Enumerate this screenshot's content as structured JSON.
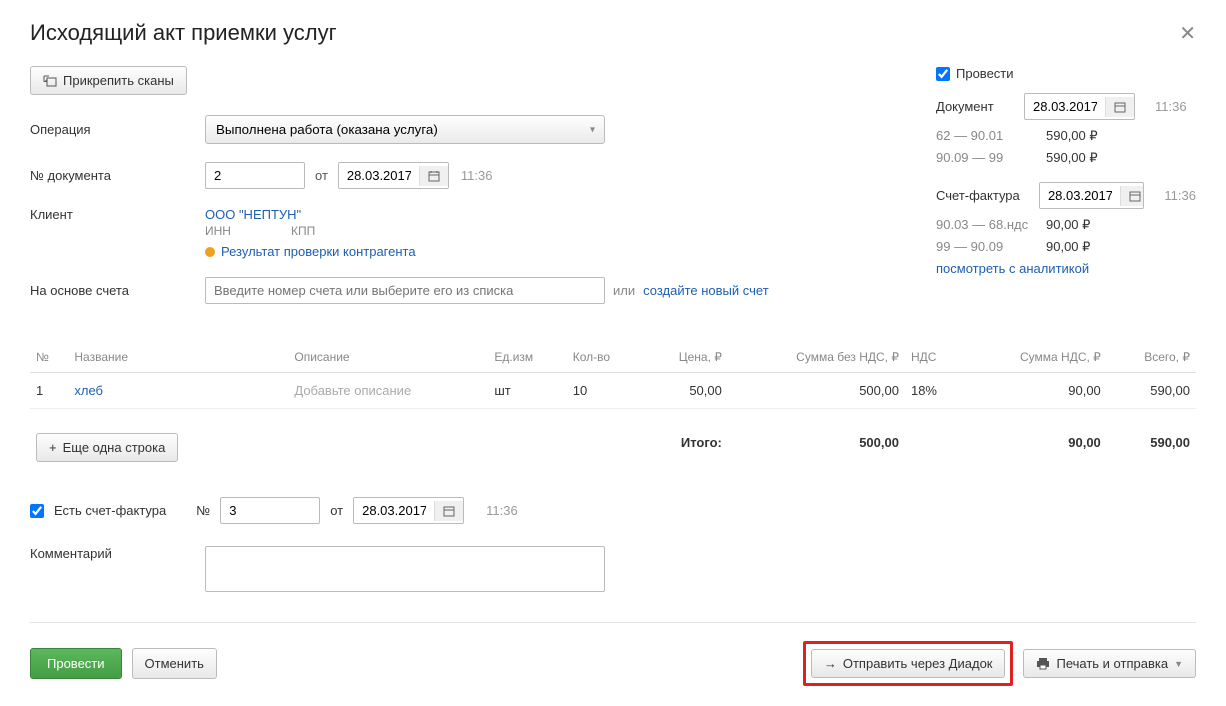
{
  "title": "Исходящий акт приемки услуг",
  "attach_btn": "Прикрепить сканы",
  "operation": {
    "label": "Операция",
    "value": "Выполнена работа (оказана услуга)"
  },
  "doc_number": {
    "label": "№ документа",
    "value": "2",
    "from": "от",
    "date": "28.03.2017",
    "time": "11:36"
  },
  "client": {
    "label": "Клиент",
    "name": "ООО \"НЕПТУН\"",
    "inn_label": "ИНН",
    "kpp_label": "КПП",
    "check_link": "Результат проверки контрагента"
  },
  "basis": {
    "label": "На основе счета",
    "placeholder": "Введите номер счета или выберите его из списка",
    "or": "или",
    "new_link": "создайте новый счет"
  },
  "right": {
    "post_checkbox": "Провести",
    "document": {
      "label": "Документ",
      "date": "28.03.2017",
      "time": "11:36"
    },
    "lines1": [
      {
        "acct": "62 — 90.01",
        "amt": "590,00 ₽"
      },
      {
        "acct": "90.09 — 99",
        "amt": "590,00 ₽"
      }
    ],
    "invoice": {
      "label": "Счет-фактура",
      "date": "28.03.2017",
      "time": "11:36"
    },
    "lines2": [
      {
        "acct": "90.03 — 68.ндс",
        "amt": "90,00 ₽"
      },
      {
        "acct": "99 — 90.09",
        "amt": "90,00 ₽"
      }
    ],
    "analytics_link": "посмотреть с аналитикой"
  },
  "table": {
    "headers": {
      "no": "№",
      "name": "Название",
      "desc": "Описание",
      "unit": "Ед.изм",
      "qty": "Кол-во",
      "price": "Цена, ₽",
      "sum_no_vat": "Сумма без НДС, ₽",
      "vat": "НДС",
      "vat_sum": "Сумма НДС, ₽",
      "total": "Всего, ₽"
    },
    "rows": [
      {
        "no": "1",
        "name": "хлеб",
        "desc_ph": "Добавьте описание",
        "unit": "шт",
        "qty": "10",
        "price": "50,00",
        "sum_no_vat": "500,00",
        "vat": "18%",
        "vat_sum": "90,00",
        "total": "590,00"
      }
    ],
    "totals": {
      "label": "Итого:",
      "sum_no_vat": "500,00",
      "vat_sum": "90,00",
      "total": "590,00"
    }
  },
  "add_row": "Еще одна строка",
  "sf": {
    "checkbox": "Есть счет-фактура",
    "no_label": "№",
    "no": "3",
    "from": "от",
    "date": "28.03.2017",
    "time": "11:36"
  },
  "comment_label": "Комментарий",
  "footer": {
    "submit": "Провести",
    "cancel": "Отменить",
    "diadoc": "Отправить через Диадок",
    "print": "Печать и отправка"
  }
}
